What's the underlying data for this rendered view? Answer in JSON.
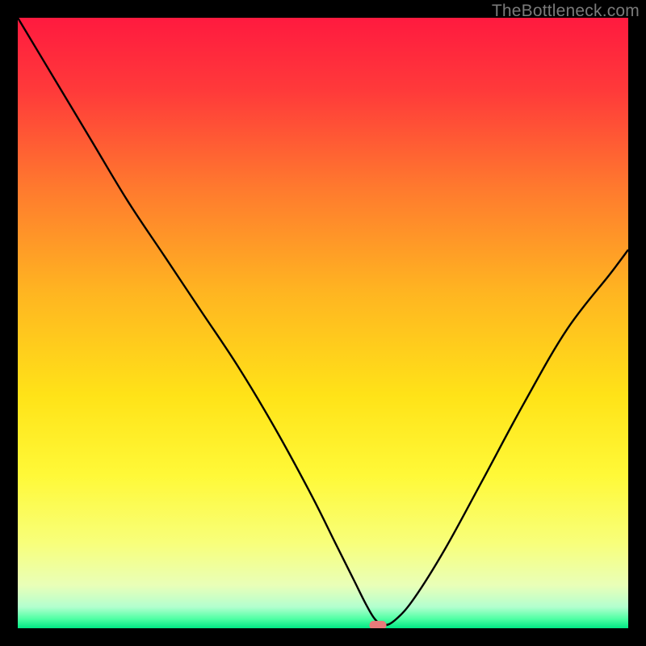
{
  "watermark": "TheBottleneck.com",
  "chart_data": {
    "type": "line",
    "title": "",
    "xlabel": "",
    "ylabel": "",
    "xlim": [
      0,
      100
    ],
    "ylim": [
      0,
      100
    ],
    "grid": false,
    "legend": false,
    "gradient_stops": [
      {
        "offset": 0.0,
        "color": "#ff1a3f"
      },
      {
        "offset": 0.12,
        "color": "#ff3a3a"
      },
      {
        "offset": 0.28,
        "color": "#ff7a2e"
      },
      {
        "offset": 0.45,
        "color": "#ffb521"
      },
      {
        "offset": 0.62,
        "color": "#ffe318"
      },
      {
        "offset": 0.75,
        "color": "#fff938"
      },
      {
        "offset": 0.86,
        "color": "#f8ff7a"
      },
      {
        "offset": 0.93,
        "color": "#e9ffb8"
      },
      {
        "offset": 0.965,
        "color": "#b3ffcf"
      },
      {
        "offset": 0.985,
        "color": "#4dffa3"
      },
      {
        "offset": 1.0,
        "color": "#00e884"
      }
    ],
    "series": [
      {
        "name": "bottleneck-curve",
        "type": "line",
        "color": "#000000",
        "x": [
          0,
          6,
          12,
          18,
          24,
          30,
          36,
          42,
          48,
          52,
          55,
          57,
          58.5,
          60,
          62,
          65,
          70,
          76,
          83,
          90,
          97,
          100
        ],
        "y": [
          100,
          90,
          80,
          70,
          61,
          52,
          43,
          33,
          22,
          14,
          8,
          4,
          1.5,
          0.5,
          1.5,
          5,
          13,
          24,
          37,
          49,
          58,
          62
        ]
      }
    ],
    "marker": {
      "name": "optimal-marker",
      "shape": "capsule",
      "color": "#e87a7a",
      "x": 59,
      "y": 0.5,
      "width_pct": 2.8,
      "height_pct": 1.4
    }
  }
}
